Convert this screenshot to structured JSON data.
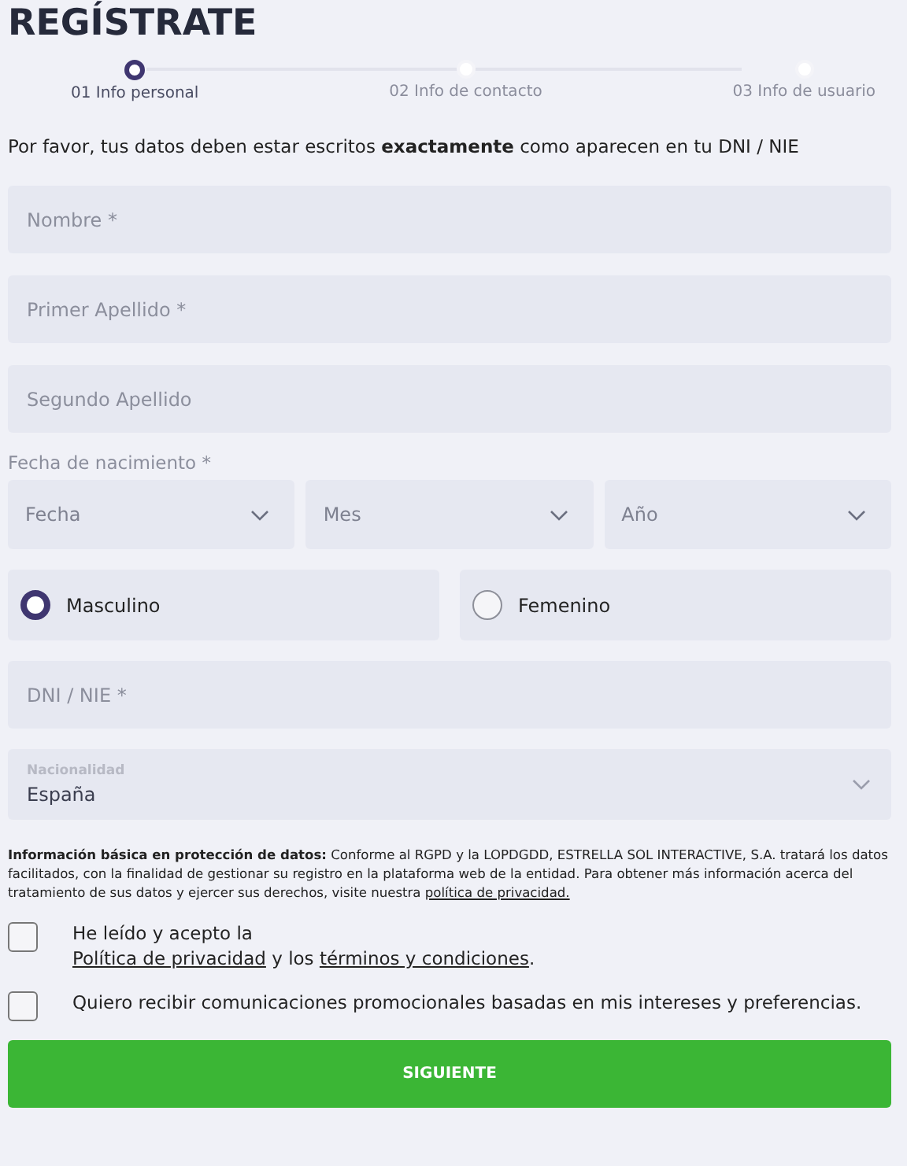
{
  "title": "REGÍSTRATE",
  "steps": [
    {
      "label": "01 Info personal",
      "selected": true
    },
    {
      "label": "02 Info de contacto",
      "selected": false
    },
    {
      "label": "03 Info de usuario",
      "selected": false
    }
  ],
  "intro": "Por favor, tus datos deben estar escritos **exactamente** como aparecen en tu DNI / NIE",
  "name_fields": [
    {
      "placeholder": "Nombre *"
    },
    {
      "placeholder": "Primer Apellido *"
    },
    {
      "placeholder": "Segundo Apellido"
    }
  ],
  "birth_date": {
    "label": "Fecha de nacimiento *",
    "selects": [
      {
        "placeholder": "Fecha"
      },
      {
        "placeholder": "Mes"
      },
      {
        "placeholder": "Año"
      }
    ]
  },
  "gender": [
    {
      "label": "Masculino",
      "selected": true
    },
    {
      "label": "Femenino",
      "selected": false
    }
  ],
  "id_field": {
    "placeholder": "DNI / NIE *"
  },
  "nationality": {
    "label": "Nacionalidad",
    "value": "España"
  },
  "privacy": {
    "title": "Información básica en protección de datos:",
    "text": "Conforme al RGPD y la LOPDGDD, ESTRELLA SOL INTERACTIVE, S.A. tratará los datos facilitados, con la finalidad de gestionar su registro en la plataforma web de la entidad. Para obtener más información acerca del tratamiento de sus datos y ejercer sus derechos, visite nuestra",
    "link": "política de privacidad."
  },
  "consents": [
    {
      "kind": "legal",
      "checked": false,
      "lead": "He leído y acepto la",
      "link_1": "Política de privacidad",
      "joiner": "y los",
      "link_2": "términos y condiciones",
      "end": "."
    },
    {
      "kind": "plain",
      "checked": false,
      "text": "Quiero recibir comunicaciones promocionales basadas en mis intereses y preferencias."
    }
  ],
  "button": "SIGUIENTE"
}
